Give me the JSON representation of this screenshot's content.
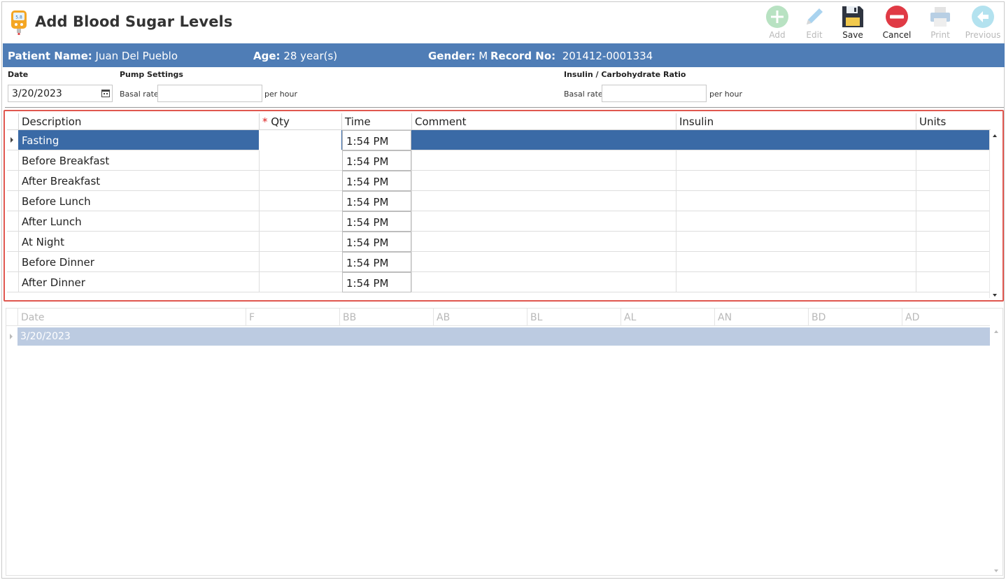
{
  "window": {
    "title": "Add Blood Sugar Levels",
    "app_icon": "glucose-meter-icon"
  },
  "toolbar": {
    "add": {
      "label": "Add",
      "icon": "add-icon",
      "enabled": false
    },
    "edit": {
      "label": "Edit",
      "icon": "edit-pencil-icon",
      "enabled": false
    },
    "save": {
      "label": "Save",
      "icon": "save-floppy-icon",
      "enabled": true
    },
    "cancel": {
      "label": "Cancel",
      "icon": "cancel-icon",
      "enabled": true
    },
    "print": {
      "label": "Print",
      "icon": "print-icon",
      "enabled": false
    },
    "previous": {
      "label": "Previous",
      "icon": "previous-arrow-icon",
      "enabled": false
    }
  },
  "patient": {
    "name_label": "Patient Name:",
    "name": "Juan Del Pueblo",
    "age_label": "Age:",
    "age": "28 year(s)",
    "gender_label": "Gender:",
    "gender": "M",
    "record_label": "Record No:",
    "record": "201412-0001334"
  },
  "form": {
    "date_label": "Date",
    "date_value": "3/20/2023",
    "pump_settings_label": "Pump Settings",
    "pump_basal_label": "Basal rate",
    "pump_basal_value": "",
    "pump_unit": "per hour",
    "ratio_label": "Insulin / Carbohydrate Ratio",
    "ratio_basal_label": "Basal rate",
    "ratio_basal_value": "",
    "ratio_unit": "per hour"
  },
  "readings_grid": {
    "columns": {
      "description": "Description",
      "qty": "Qty",
      "qty_required": "*",
      "time": "Time",
      "comment": "Comment",
      "insulin": "Insulin",
      "units": "Units"
    },
    "rows": [
      {
        "description": "Fasting",
        "qty": "",
        "time": "1:54 PM",
        "comment": "",
        "insulin": "",
        "units": ""
      },
      {
        "description": "Before Breakfast",
        "qty": "",
        "time": "1:54 PM",
        "comment": "",
        "insulin": "",
        "units": ""
      },
      {
        "description": "After Breakfast",
        "qty": "",
        "time": "1:54 PM",
        "comment": "",
        "insulin": "",
        "units": ""
      },
      {
        "description": "Before Lunch",
        "qty": "",
        "time": "1:54 PM",
        "comment": "",
        "insulin": "",
        "units": ""
      },
      {
        "description": "After Lunch",
        "qty": "",
        "time": "1:54 PM",
        "comment": "",
        "insulin": "",
        "units": ""
      },
      {
        "description": "At Night",
        "qty": "",
        "time": "1:54 PM",
        "comment": "",
        "insulin": "",
        "units": ""
      },
      {
        "description": "Before Dinner",
        "qty": "",
        "time": "1:54 PM",
        "comment": "",
        "insulin": "",
        "units": ""
      },
      {
        "description": "After Dinner",
        "qty": "",
        "time": "1:54 PM",
        "comment": "",
        "insulin": "",
        "units": ""
      }
    ]
  },
  "history_grid": {
    "columns": [
      "Date",
      "F",
      "BB",
      "AB",
      "BL",
      "AL",
      "AN",
      "BD",
      "AD"
    ],
    "rows": [
      {
        "date": "3/20/2023"
      }
    ]
  },
  "colors": {
    "patient_bar": "#4f7db6",
    "selected_row": "#3a6aa6",
    "highlight_border": "#e0574f",
    "history_row": "#bccbe1"
  }
}
